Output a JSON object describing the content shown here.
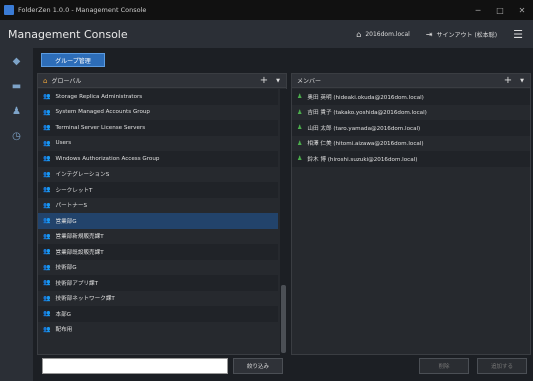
{
  "window": {
    "title": "FolderZen 1.0.0 - Management Console",
    "minimize": "─",
    "maximize": "□",
    "close": "✕"
  },
  "header": {
    "app_title": "Management Console",
    "domain_label": "2016dom.local",
    "signout_label": "サインアウト (松本聡)"
  },
  "tab": {
    "label": "グループ管理"
  },
  "groups_panel": {
    "title": "グローバル",
    "items": [
      "Storage Replica Administrators",
      "System Managed Accounts Group",
      "Terminal Server License Servers",
      "Users",
      "Windows Authorization Access Group",
      "インテグレーションS",
      "シークレットT",
      "パートナーS",
      "営業部G",
      "営業部新規販売課T",
      "営業部既設販売課T",
      "技術部G",
      "技術部アプリ課T",
      "技術部ネットワーク課T",
      "本部G",
      "配布用"
    ],
    "selected_index": 8
  },
  "members_panel": {
    "title": "メンバー",
    "items": [
      "奥田 英明 (hideaki.okuda@2016dom.local)",
      "吉田 貴子 (takako.yoshida@2016dom.local)",
      "山田 太郎 (taro.yamada@2016dom.local)",
      "相澤 仁美 (hitomi.aizawa@2016dom.local)",
      "鈴木 博 (hiroshi.suzuki@2016dom.local)"
    ]
  },
  "footer": {
    "search_value": "",
    "filter_button": "絞り込み",
    "delete_button": "削除",
    "add_button": "追加する"
  },
  "icons": {
    "group": "group-icon",
    "user": "user-icon",
    "folder": "folder-icon"
  }
}
